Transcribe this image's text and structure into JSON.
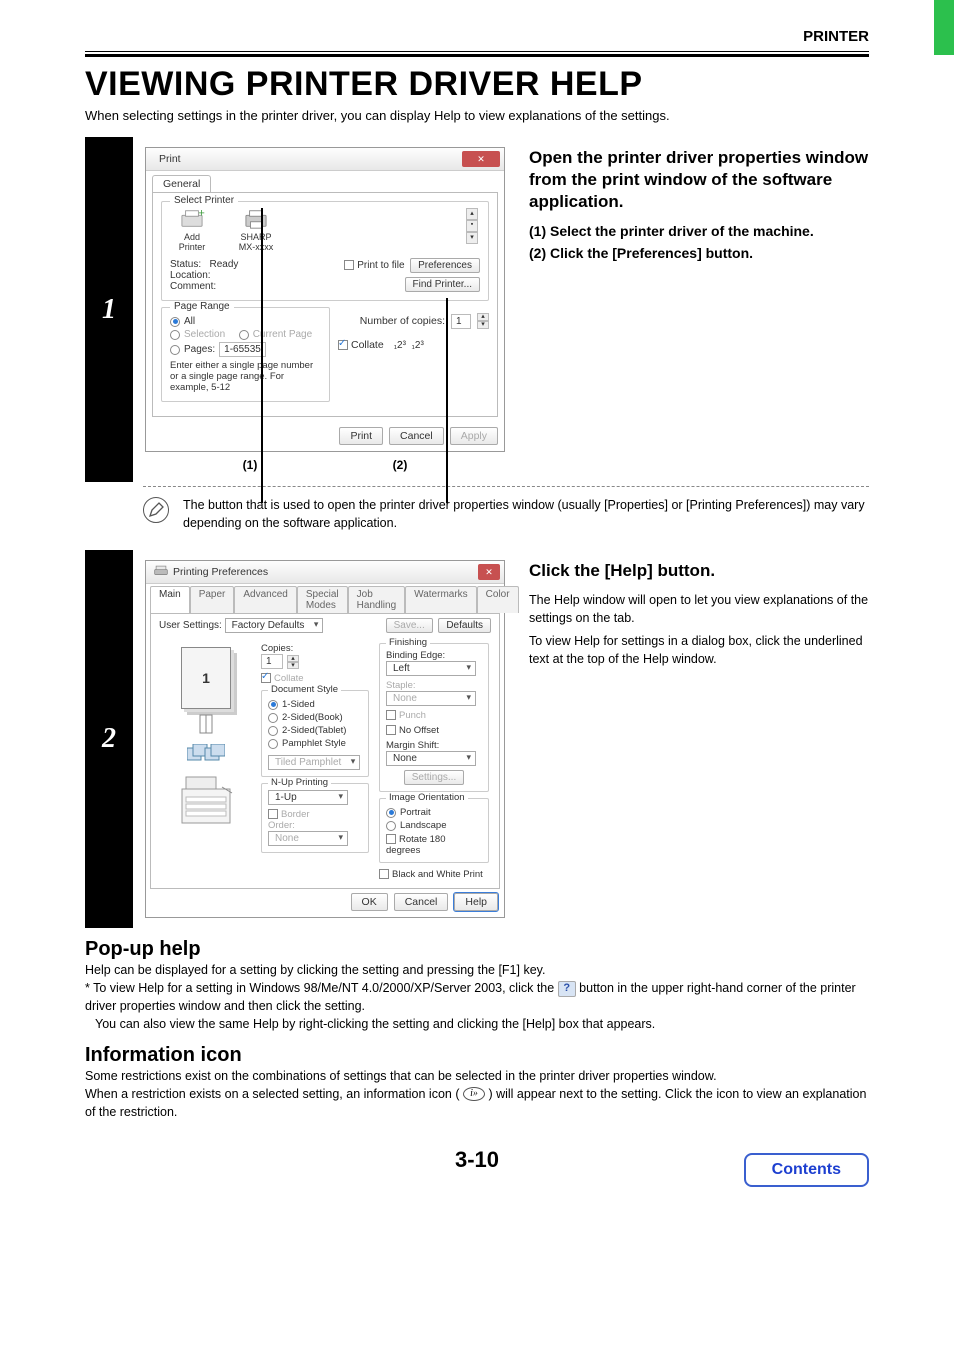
{
  "header": {
    "section": "PRINTER"
  },
  "title": "VIEWING PRINTER DRIVER HELP",
  "intro": "When selecting settings in the printer driver, you can display Help to view explanations of the settings.",
  "step1": {
    "num": "1",
    "heading": "Open the printer driver properties window from the print window of the software application.",
    "sub1": "(1)  Select the printer driver of the machine.",
    "sub2": "(2)  Click the [Preferences] button.",
    "callout1": "(1)",
    "callout2": "(2)",
    "dialog": {
      "title": "Print",
      "tab": "General",
      "select_printer": "Select Printer",
      "add_printer": "Add Printer",
      "printer_name": "SHARP\nMX-xxxx",
      "status_label": "Status:",
      "status_value": "Ready",
      "location_label": "Location:",
      "comment_label": "Comment:",
      "print_to_file": "Print to file",
      "preferences_btn": "Preferences",
      "find_printer_btn": "Find Printer...",
      "page_range": "Page Range",
      "all": "All",
      "selection": "Selection",
      "current_page": "Current Page",
      "pages": "Pages:",
      "pages_val": "1-65535",
      "pages_hint": "Enter either a single page number or a single page range.  For example, 5-12",
      "copies_label": "Number of copies:",
      "copies_val": "1",
      "collate": "Collate",
      "print_btn": "Print",
      "cancel_btn": "Cancel",
      "apply_btn": "Apply"
    }
  },
  "note1": "The button that is used to open the printer driver properties window (usually [Properties] or [Printing Preferences]) may vary depending on the software application.",
  "step2": {
    "num": "2",
    "heading": "Click the [Help] button.",
    "p1": "The Help window will open to let you view explanations of the settings on the tab.",
    "p2": "To view Help for settings in a dialog box, click the underlined text at the top of the Help window.",
    "dialog": {
      "title": "Printing Preferences",
      "tabs": [
        "Main",
        "Paper",
        "Advanced",
        "Special Modes",
        "Job Handling",
        "Watermarks",
        "Color"
      ],
      "user_settings": "User Settings:",
      "user_settings_val": "Factory Defaults",
      "save_btn": "Save...",
      "defaults_btn": "Defaults",
      "copies_label": "Copies:",
      "copies_val": "1",
      "collate": "Collate",
      "doc_style": "Document Style",
      "ds_1sided": "1-Sided",
      "ds_2book": "2-Sided(Book)",
      "ds_2tablet": "2-Sided(Tablet)",
      "ds_pamphlet": "Pamphlet Style",
      "tiled_pamphlet": "Tiled Pamphlet",
      "nup": "N-Up Printing",
      "nup_val": "1-Up",
      "border": "Border",
      "order": "Order:",
      "order_val": "None",
      "finishing": "Finishing",
      "binding_edge": "Binding Edge:",
      "binding_val": "Left",
      "staple": "Staple:",
      "staple_val": "None",
      "punch": "Punch",
      "no_offset": "No Offset",
      "margin_shift": "Margin Shift:",
      "margin_val": "None",
      "settings_btn": "Settings...",
      "orient": "Image Orientation",
      "portrait": "Portrait",
      "landscape": "Landscape",
      "rotate": "Rotate 180 degrees",
      "bw": "Black and White Print",
      "ok": "OK",
      "cancel": "Cancel",
      "help": "Help"
    }
  },
  "popup": {
    "title": "Pop-up help",
    "line1": "Help can be displayed for a setting by clicking the setting and pressing the [F1] key.",
    "line2a": "* To view Help for a setting in Windows 98/Me/NT 4.0/2000/XP/Server 2003, click the ",
    "line2b": " button in the upper right-hand corner of the printer driver properties window and then click the setting.",
    "line3": "You can also view the same Help by right-clicking the setting and clicking the [Help] box that appears."
  },
  "info": {
    "title": "Information icon",
    "line1": "Some restrictions exist on the combinations of settings that can be selected in the printer driver properties window.",
    "line2a": "When a restriction exists on a selected setting, an information icon ( ",
    "line2b": " ) will appear next to the setting. Click the icon to view an explanation of the restriction."
  },
  "page_number": "3-10",
  "contents_btn": "Contents"
}
